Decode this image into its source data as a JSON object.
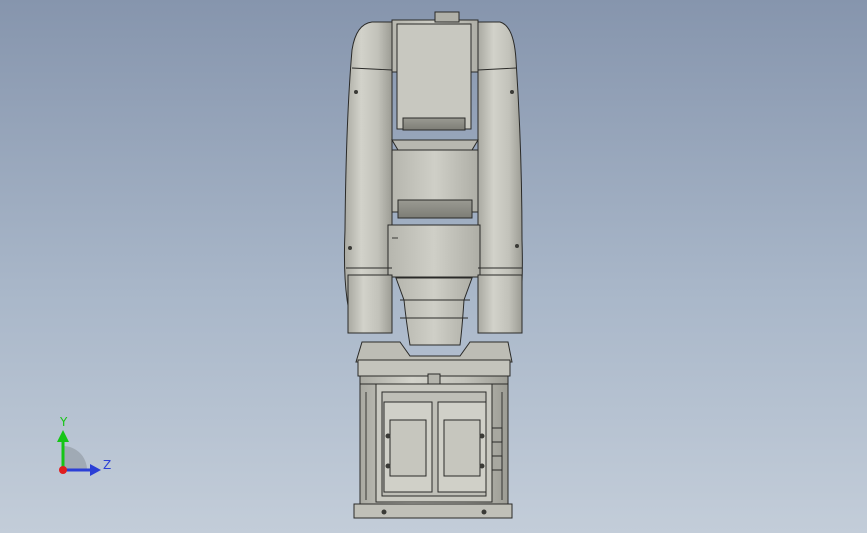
{
  "view": {
    "background_top": "#8695ad",
    "background_bottom": "#c3cdd9",
    "model_body_color": "#c6c6be",
    "model_shadow_color": "#9a9a92",
    "edge_color": "#2a2a28"
  },
  "triad": {
    "y_label": "Y",
    "z_label": "Z",
    "y_color": "#16c516",
    "z_color": "#2b3fd6",
    "x_color": "#e01e1e"
  }
}
